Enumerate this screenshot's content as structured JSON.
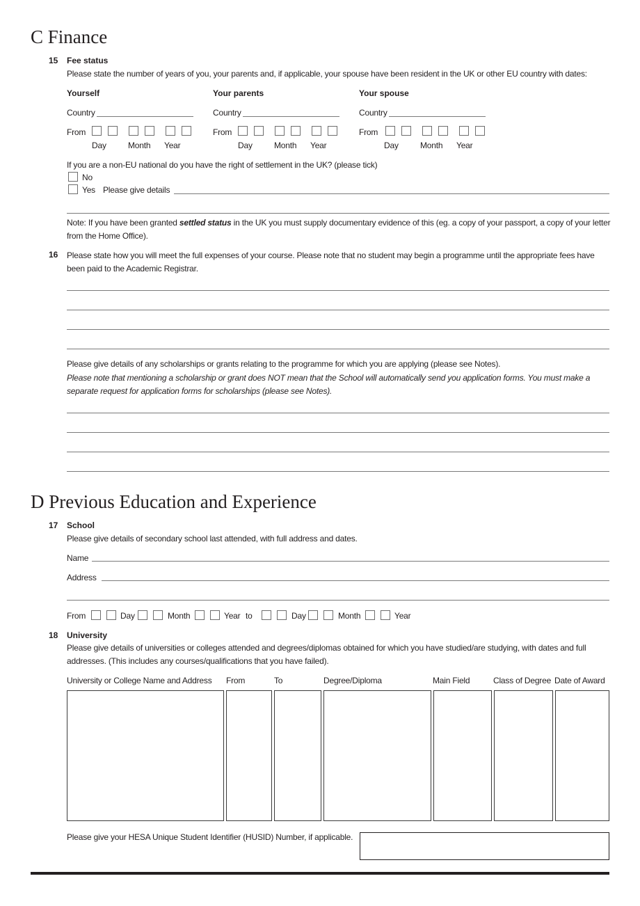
{
  "section_c": {
    "title": "C Finance",
    "q15": {
      "number": "15",
      "title": "Fee status",
      "intro": "Please state the number of years of you, your parents and, if applicable, your spouse have been resident in the UK or other EU country with dates:",
      "columns": [
        {
          "heading": "Yourself",
          "country_label": "Country",
          "from_label": "From",
          "day": "Day",
          "month": "Month",
          "year": "Year"
        },
        {
          "heading": "Your parents",
          "country_label": "Country",
          "from_label": "From",
          "day": "Day",
          "month": "Month",
          "year": "Year"
        },
        {
          "heading": "Your spouse",
          "country_label": "Country",
          "from_label": "From",
          "day": "Day",
          "month": "Month",
          "year": "Year"
        }
      ],
      "settlement_question": "If you are a non-EU national do you have the right of settlement in the UK? (please tick)",
      "option_no": "No",
      "option_yes": "Yes",
      "details_label": "Please give details",
      "note_prefix": "Note: If you have been granted ",
      "note_bold": "settled status",
      "note_suffix": " in the UK you must supply documentary evidence of this (eg. a copy of your passport, a copy of your letter from the Home Office)."
    },
    "q16": {
      "number": "16",
      "text": "Please state how you will meet the full expenses of your course. Please note that no student may begin a programme until the appropriate fees have been paid to the Academic Registrar.",
      "scholarship_text": "Please give details of any scholarships or grants relating to the programme for which you are applying (please see Notes).",
      "scholarship_note": "Please note that mentioning a scholarship or grant does NOT mean that the School will automatically send you application forms. You must make a separate request for application forms for scholarships (please see Notes)."
    }
  },
  "section_d": {
    "title": "D Previous Education and Experience",
    "q17": {
      "number": "17",
      "title": "School",
      "intro": "Please give details of secondary school last attended, with full address and dates.",
      "name_label": "Name",
      "address_label": "Address",
      "from_label": "From",
      "day": "Day",
      "month": "Month",
      "year": "Year",
      "to_label": "to"
    },
    "q18": {
      "number": "18",
      "title": "University",
      "intro": "Please give details of universities or colleges attended and degrees/diplomas obtained for which you have studied/are studying, with dates and full addresses. (This includes any courses/qualifications that you have failed).",
      "columns": [
        "University or College Name and Address",
        "From",
        "To",
        "Degree/Diploma",
        "Main Field",
        "Class of Degree",
        "Date of Award"
      ],
      "husid_label": "Please give your HESA Unique Student Identifier (HUSID) Number, if applicable."
    }
  }
}
